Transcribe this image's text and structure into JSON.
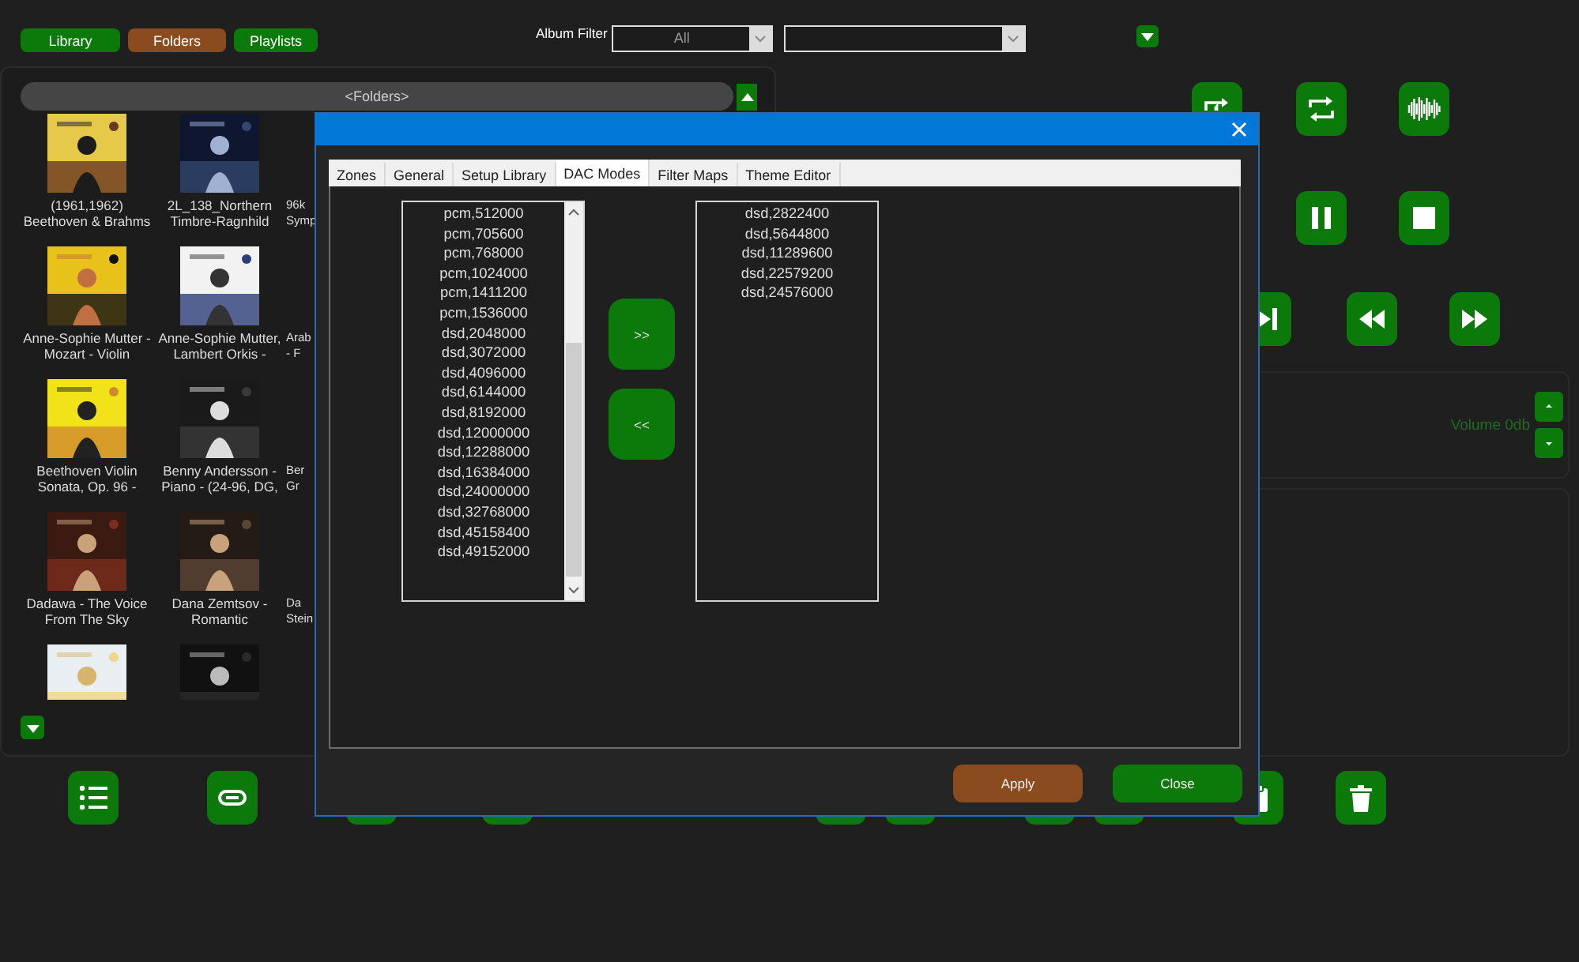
{
  "top_bar": {
    "tabs": [
      {
        "label": "Library",
        "selected": false
      },
      {
        "label": "Folders",
        "selected": true
      },
      {
        "label": "Playlists",
        "selected": false
      }
    ],
    "album_filter": {
      "label": "Album Filter",
      "value": "All"
    }
  },
  "folders": {
    "title": "<Folders>",
    "rows": [
      {
        "cells": [
          {
            "kind": "album",
            "lines": [
              "(1961,1962)",
              "Beethoven & Brahms"
            ]
          },
          {
            "kind": "album",
            "lines": [
              "2L_138_Northern",
              "Timbre-Ragnhild"
            ]
          },
          {
            "kind": "cut",
            "lines": [
              "96k",
              "Symp"
            ]
          }
        ]
      },
      {
        "cells": [
          {
            "kind": "album",
            "lines": [
              "Anne-Sophie Mutter -",
              "Mozart - Violin"
            ]
          },
          {
            "kind": "album",
            "lines": [
              "Anne-Sophie Mutter,",
              "Lambert Orkis -"
            ]
          },
          {
            "kind": "cut",
            "lines": [
              "Arab",
              "- F"
            ]
          }
        ]
      },
      {
        "cells": [
          {
            "kind": "album",
            "lines": [
              "Beethoven Violin",
              "Sonata, Op. 96 -"
            ]
          },
          {
            "kind": "album",
            "lines": [
              "Benny Andersson -",
              "Piano - (24-96, DG,"
            ]
          },
          {
            "kind": "cut",
            "lines": [
              "Ber",
              "Gr"
            ]
          }
        ]
      },
      {
        "cells": [
          {
            "kind": "album",
            "lines": [
              "Dadawa - The Voice",
              "From The Sky"
            ]
          },
          {
            "kind": "album",
            "lines": [
              "Dana Zemtsov -",
              "Romantic"
            ]
          },
          {
            "kind": "cut",
            "lines": [
              "Da",
              "Stein"
            ]
          }
        ]
      },
      {
        "cells": [
          {
            "kind": "cover"
          },
          {
            "kind": "cover"
          }
        ]
      }
    ]
  },
  "volume": {
    "label": "Volume 0db"
  },
  "dialog": {
    "tabs": [
      {
        "label": "Zones",
        "selected": false
      },
      {
        "label": "General",
        "selected": false
      },
      {
        "label": "Setup Library",
        "selected": false
      },
      {
        "label": "DAC Modes",
        "selected": true
      },
      {
        "label": "Filter Maps",
        "selected": false
      },
      {
        "label": "Theme Editor",
        "selected": false
      }
    ],
    "available_modes": [
      "pcm,512000",
      "pcm,705600",
      "pcm,768000",
      "pcm,1024000",
      "pcm,1411200",
      "pcm,1536000",
      "dsd,2048000",
      "dsd,3072000",
      "dsd,4096000",
      "dsd,6144000",
      "dsd,8192000",
      "dsd,12000000",
      "dsd,12288000",
      "dsd,16384000",
      "dsd,24000000",
      "dsd,32768000",
      "dsd,45158400",
      "dsd,49152000"
    ],
    "selected_modes": [
      "dsd,2822400",
      "dsd,5644800",
      "dsd,11289600",
      "dsd,22579200",
      "dsd,24576000"
    ],
    "move_right": ">>",
    "move_left": "<<",
    "apply": "Apply",
    "close": "Close"
  }
}
